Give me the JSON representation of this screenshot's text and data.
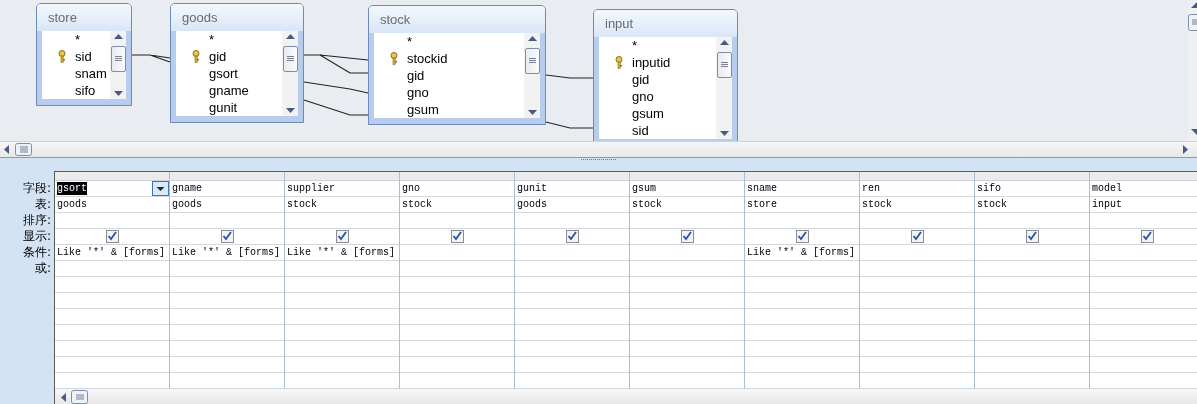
{
  "tables": [
    {
      "name": "store",
      "fields": [
        {
          "name": "*",
          "key": false
        },
        {
          "name": "sid",
          "key": true
        },
        {
          "name": "snam",
          "key": false
        },
        {
          "name": "sifo",
          "key": false
        }
      ]
    },
    {
      "name": "goods",
      "fields": [
        {
          "name": "*",
          "key": false
        },
        {
          "name": "gid",
          "key": true
        },
        {
          "name": "gsort",
          "key": false
        },
        {
          "name": "gname",
          "key": false
        },
        {
          "name": "gunit",
          "key": false
        }
      ]
    },
    {
      "name": "stock",
      "fields": [
        {
          "name": "*",
          "key": false
        },
        {
          "name": "stockid",
          "key": true
        },
        {
          "name": "gid",
          "key": false
        },
        {
          "name": "gno",
          "key": false
        },
        {
          "name": "gsum",
          "key": false
        }
      ]
    },
    {
      "name": "input",
      "fields": [
        {
          "name": "*",
          "key": false
        },
        {
          "name": "inputid",
          "key": true
        },
        {
          "name": "gid",
          "key": false
        },
        {
          "name": "gno",
          "key": false
        },
        {
          "name": "gsum",
          "key": false
        },
        {
          "name": "sid",
          "key": false
        }
      ]
    }
  ],
  "row_labels": [
    "字段:",
    "表:",
    "排序:",
    "显示:",
    "条件:",
    "或:"
  ],
  "columns": [
    {
      "field": "gsort",
      "table": "goods",
      "show": true,
      "criteria": "Like '*' & [forms]",
      "selected": true
    },
    {
      "field": "gname",
      "table": "goods",
      "show": true,
      "criteria": "Like '*' & [forms]",
      "selected": false
    },
    {
      "field": "supplier",
      "table": "stock",
      "show": true,
      "criteria": "Like '*' & [forms]",
      "selected": false
    },
    {
      "field": "gno",
      "table": "stock",
      "show": true,
      "selected": false
    },
    {
      "field": "gunit",
      "table": "goods",
      "show": true,
      "selected": false
    },
    {
      "field": "gsum",
      "table": "stock",
      "show": true,
      "selected": false
    },
    {
      "field": "sname",
      "table": "store",
      "show": true,
      "criteria": "Like '*' & [forms]",
      "selected": false
    },
    {
      "field": "ren",
      "table": "stock",
      "show": true,
      "selected": false
    },
    {
      "field": "sifo",
      "table": "stock",
      "show": true,
      "selected": false
    },
    {
      "field": "model",
      "table": "input",
      "show": true,
      "selected": false
    }
  ]
}
